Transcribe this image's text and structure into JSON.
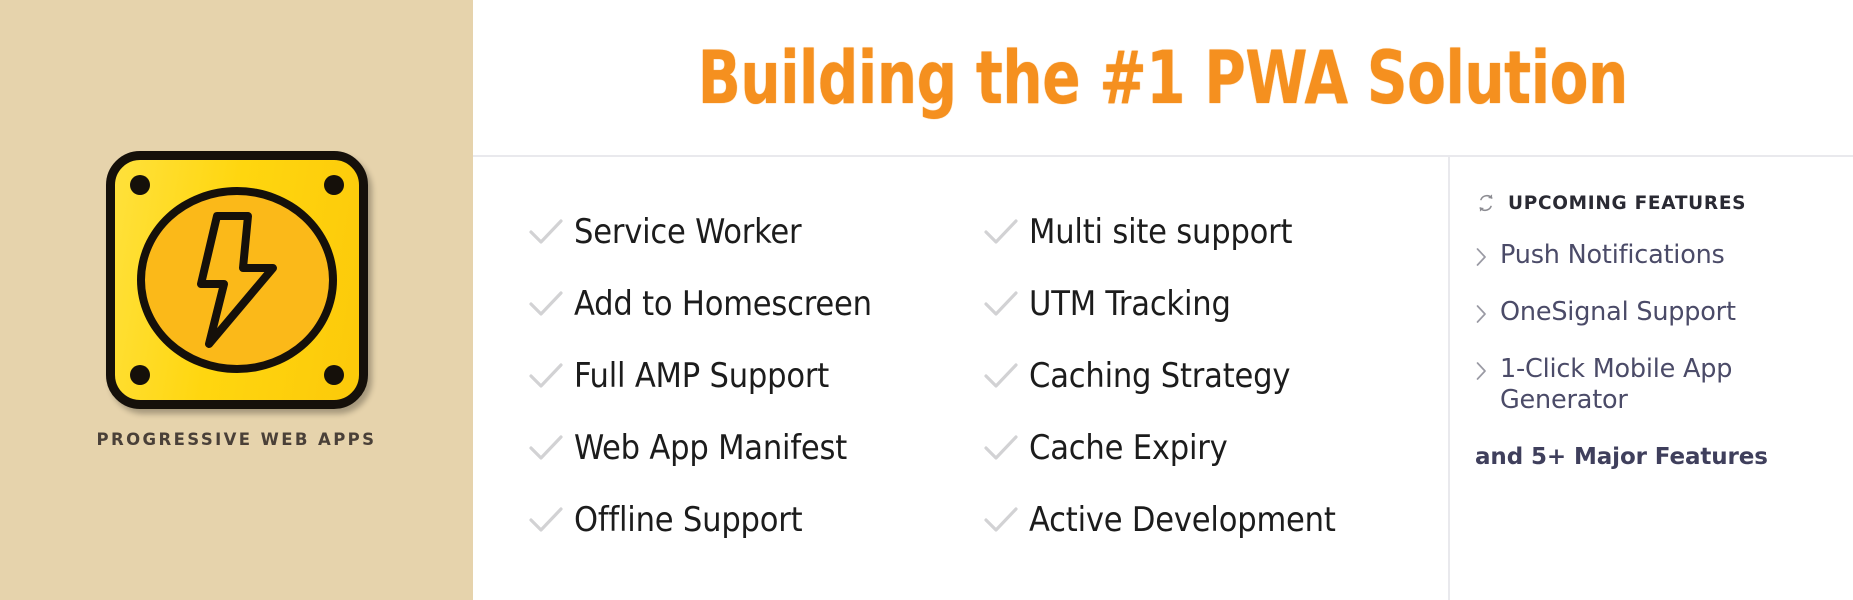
{
  "title": "Building the #1 PWA Solution",
  "brand": {
    "logo_caption": "PROGRESSIVE WEB APPS",
    "logo_icon": "lightning-bolt-icon",
    "colors": {
      "panel_background": "#E6D3AC",
      "logo_plate": "#FFD60F",
      "logo_circle": "#FBB919",
      "logo_outline": "#15100A",
      "title_orange": "#F5901F",
      "check_gray": "#D2D2D4",
      "divider": "#E9E9ED",
      "upcoming_text": "#4B4B68"
    }
  },
  "features": {
    "check_icon": "check-icon",
    "column1": [
      {
        "label": "Service Worker"
      },
      {
        "label": "Add to Homescreen"
      },
      {
        "label": "Full AMP Support"
      },
      {
        "label": "Web App Manifest"
      },
      {
        "label": "Offline Support"
      }
    ],
    "column2": [
      {
        "label": "Multi site support"
      },
      {
        "label": "UTM Tracking"
      },
      {
        "label": "Caching Strategy"
      },
      {
        "label": "Cache Expiry"
      },
      {
        "label": "Active Development"
      }
    ]
  },
  "upcoming": {
    "icon": "sync-icon",
    "heading": "UPCOMING FEATURES",
    "chevron_icon": "chevron-right-icon",
    "items": [
      {
        "label": "Push Notifications"
      },
      {
        "label": "OneSignal Support"
      },
      {
        "label": "1-Click Mobile App Generator"
      }
    ],
    "footer": "and 5+ Major Features"
  }
}
